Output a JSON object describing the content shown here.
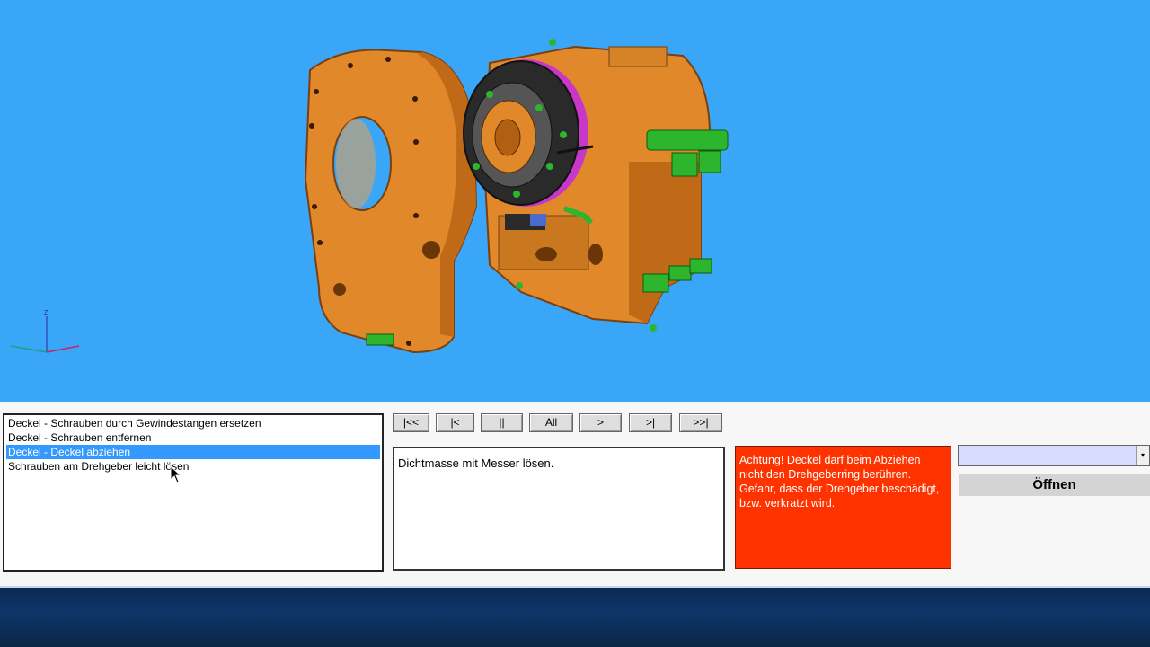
{
  "steps": [
    {
      "label": "Deckel - Schrauben durch Gewindestangen ersetzen",
      "selected": false
    },
    {
      "label": "Deckel - Schrauben entfernen",
      "selected": false
    },
    {
      "label": "Deckel - Deckel abziehen",
      "selected": true
    },
    {
      "label": "Schrauben am Drehgeber leicht lösen",
      "selected": false
    }
  ],
  "playback": {
    "first": "|<<",
    "prev": "|<",
    "pause": "||",
    "all": "All",
    "next": ">",
    "last_step": ">|",
    "end": ">>|"
  },
  "description": "Dichtmasse mit Messer lösen.",
  "warning": "Achtung! Deckel darf beim Abziehen nicht den Drehgeberring berühren. Gefahr, dass der Drehgeber beschädigt, bzw. verkratzt wird.",
  "dropdown": {
    "value": "",
    "arrow": "▾"
  },
  "open_button": "Öffnen",
  "axis_label": "Z",
  "colors": {
    "viewport_bg": "#3aa6f8",
    "part_orange": "#e0882a",
    "bolt_green": "#2db52d",
    "warning_bg": "#ff3300",
    "selection": "#3399ff"
  }
}
